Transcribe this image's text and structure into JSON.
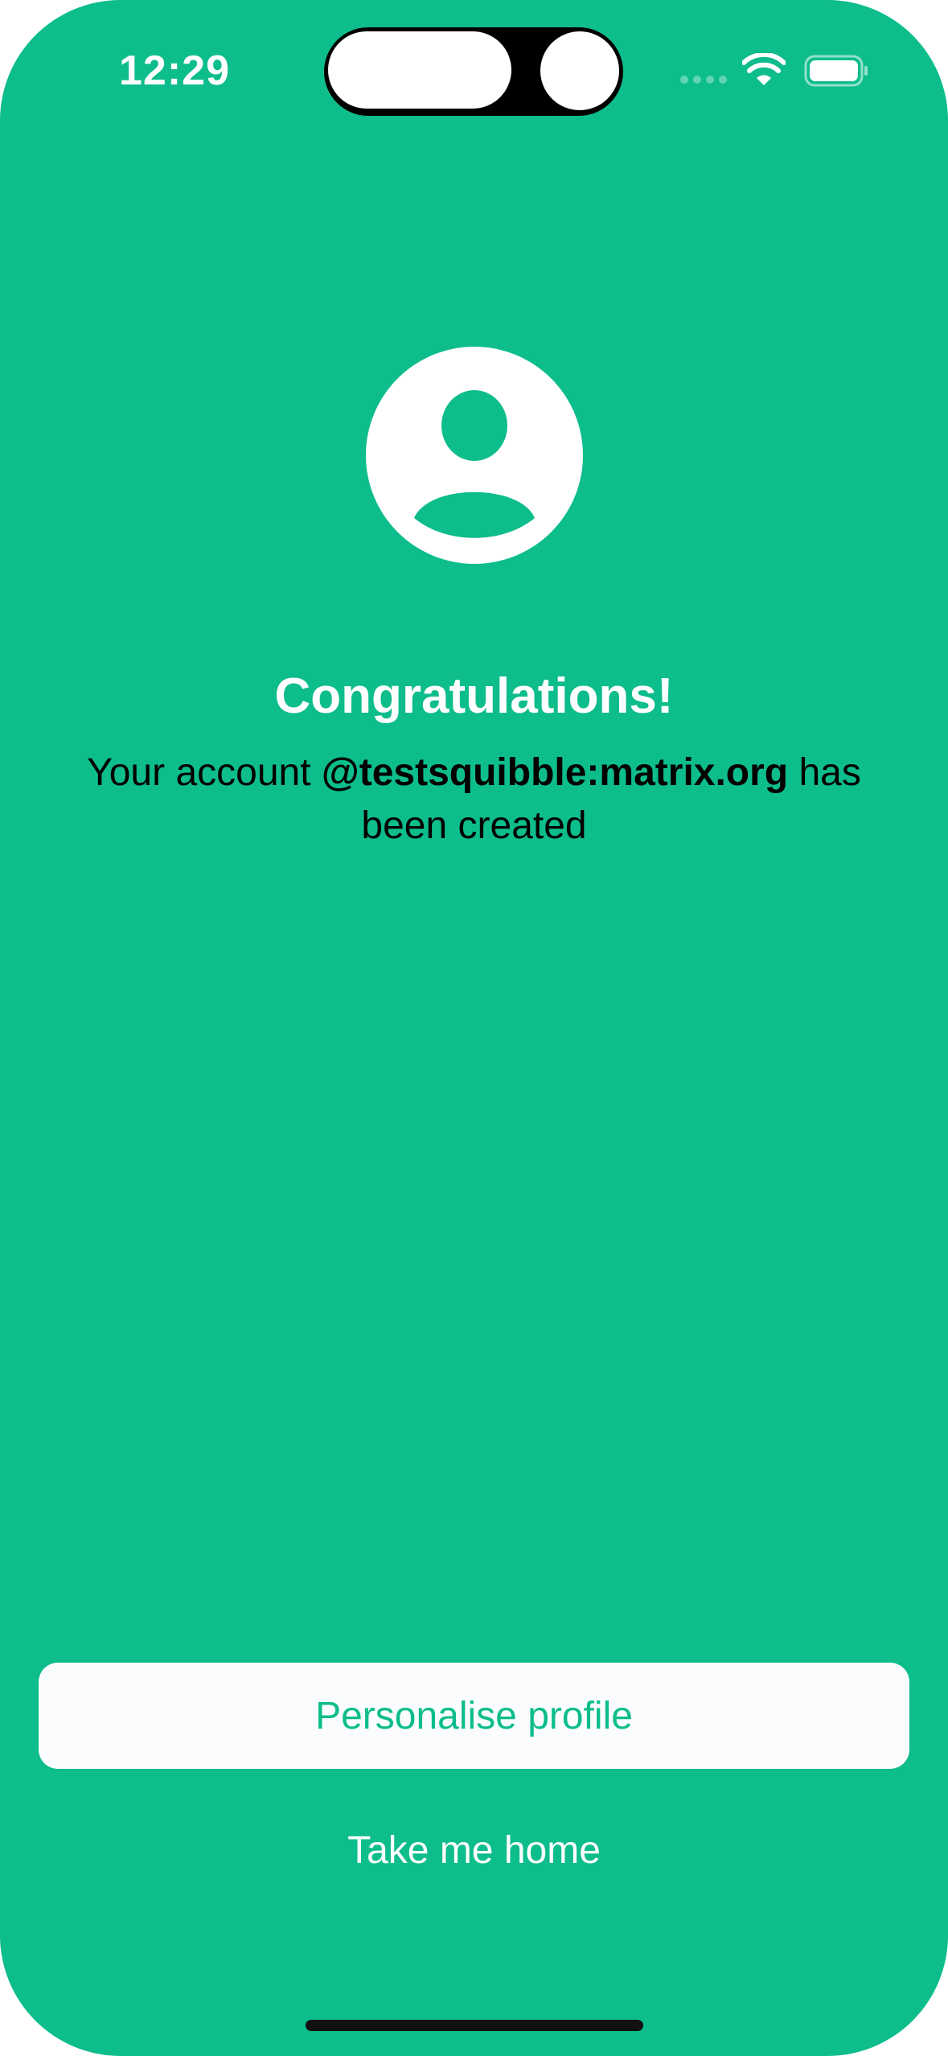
{
  "status_bar": {
    "time": "12:29"
  },
  "icons": {
    "avatar": "person-circle-icon",
    "wifi": "wifi-icon",
    "battery": "battery-icon"
  },
  "content": {
    "title": "Congratulations!",
    "message_prefix": "Your account ",
    "user_id": "@testsquibble:matrix.org",
    "message_suffix": " has been created"
  },
  "actions": {
    "personalise_label": "Personalise profile",
    "home_label": "Take me home"
  },
  "colors": {
    "background": "#0dbd8b",
    "primary_button_bg": "#fbfcfd",
    "primary_button_text": "#0dbd8b",
    "text_white": "#ffffff",
    "text_dark": "#000000"
  }
}
